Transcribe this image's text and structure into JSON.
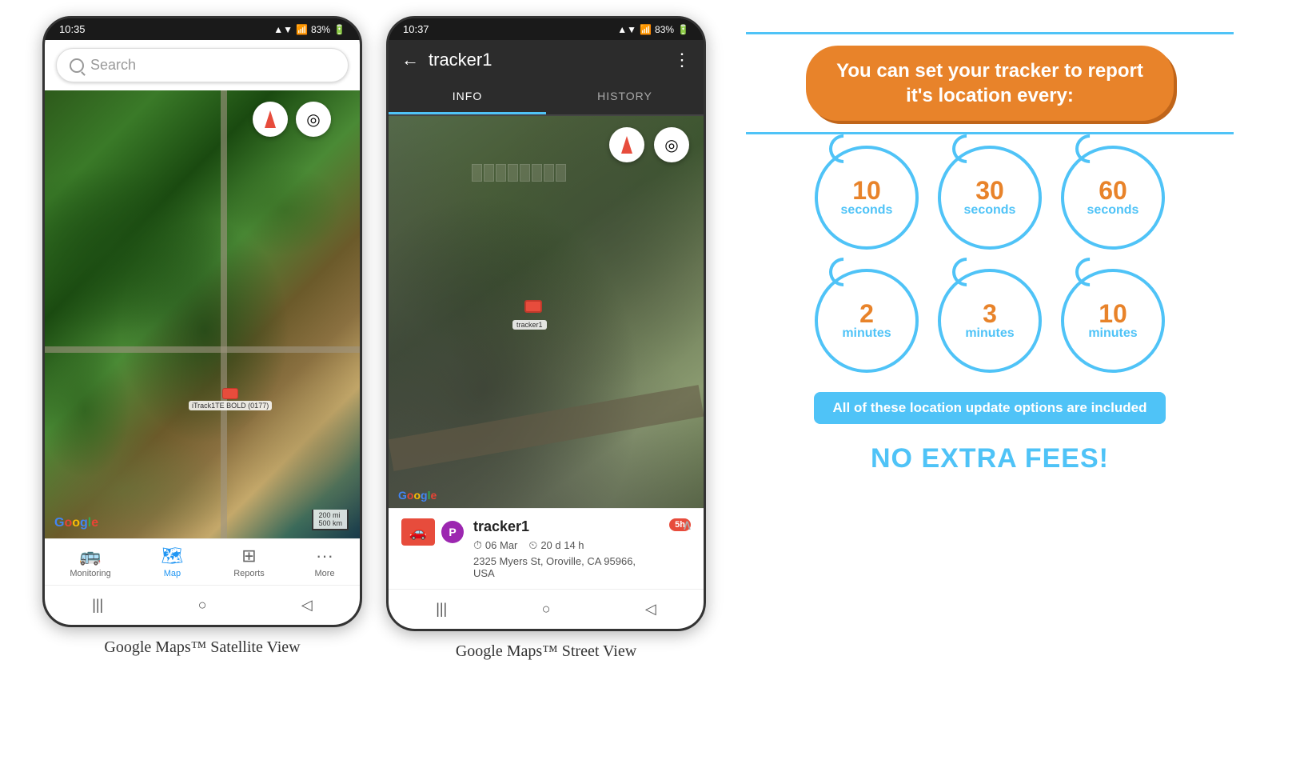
{
  "phone1": {
    "status_bar": {
      "time": "10:35",
      "signal": "▲▼",
      "wifi": "WiFi",
      "battery": "83%"
    },
    "search": {
      "placeholder": "Search"
    },
    "map": {
      "tracker_label": "iTrack1TE BOLD (0177)",
      "google_logo": "Google",
      "scale": "200 mi\n500 km"
    },
    "nav": {
      "items": [
        {
          "label": "Monitoring",
          "icon": "🚌"
        },
        {
          "label": "Map",
          "icon": "🗺",
          "active": true
        },
        {
          "label": "Reports",
          "icon": "⊞"
        },
        {
          "label": "More",
          "icon": "···"
        }
      ]
    },
    "caption": "Google Maps™ Satellite View"
  },
  "phone2": {
    "status_bar": {
      "time": "10:37",
      "battery": "83%"
    },
    "header": {
      "back": "←",
      "title": "tracker1",
      "more": "⋮"
    },
    "tabs": [
      {
        "label": "INFO",
        "active": true
      },
      {
        "label": "HISTORY",
        "active": false
      }
    ],
    "tracker": {
      "name": "tracker1",
      "date": "06 Mar",
      "duration": "20 d 14 h",
      "address": "2325 Myers St, Oroville, CA 95966, USA",
      "tracker_label": "tracker1",
      "duration_badge": "5h",
      "p_badge": "P"
    },
    "caption": "Google Maps™ Street View"
  },
  "infographic": {
    "headline": "You can set your tracker to report it's location every:",
    "circles_row1": [
      {
        "number": "10",
        "unit": "seconds"
      },
      {
        "number": "30",
        "unit": "seconds"
      },
      {
        "number": "60",
        "unit": "seconds"
      }
    ],
    "circles_row2": [
      {
        "number": "2",
        "unit": "minutes"
      },
      {
        "number": "3",
        "unit": "minutes"
      },
      {
        "number": "10",
        "unit": "minutes"
      }
    ],
    "banner": "All of these location update options are included",
    "no_fees": "NO EXTRA FEES!"
  }
}
